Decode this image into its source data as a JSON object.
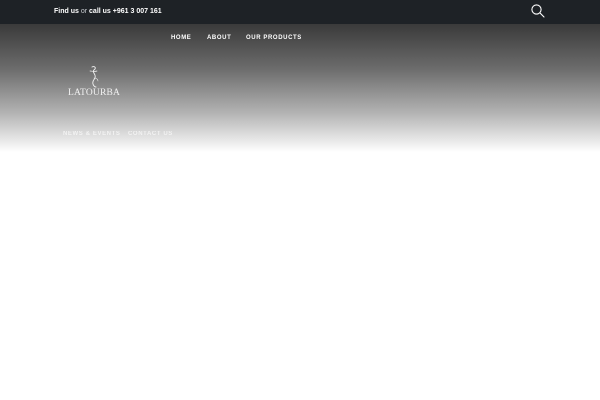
{
  "topbar": {
    "find_us": "Find us",
    "or": "or",
    "call_us": "call us +961 3 007 161",
    "search_icon": "search-icon"
  },
  "nav": {
    "primary": [
      "HOME",
      "ABOUT",
      "OUR PRODUCTS"
    ],
    "secondary": [
      "NEWS & EVENTS",
      "CONTACT US"
    ]
  },
  "logo": {
    "text": "LATOURBA",
    "icon": "logo-figure-icon"
  },
  "colors": {
    "topbar_bg": "#1e2226",
    "hero_top": "#3a3a3a",
    "page_bg": "#ffffff",
    "nav_text": "#ffffff"
  }
}
